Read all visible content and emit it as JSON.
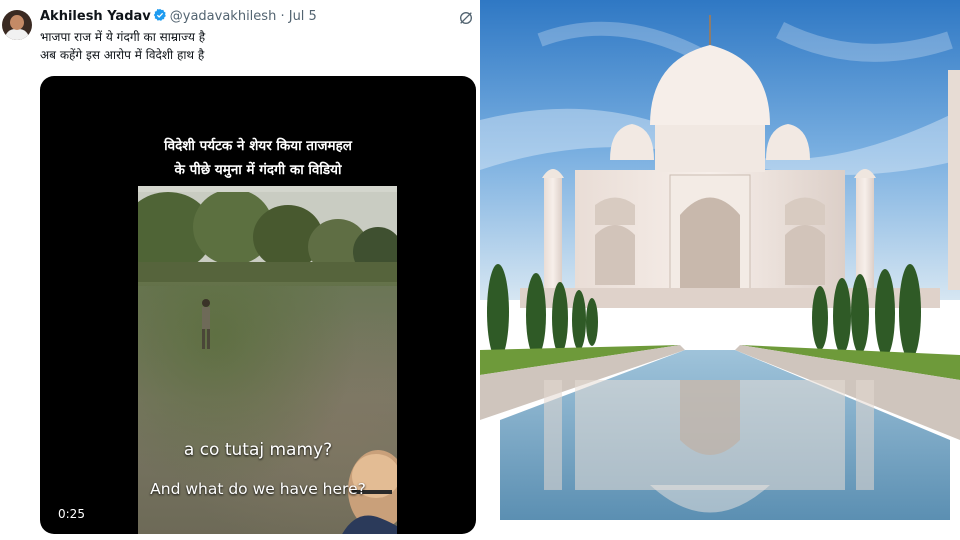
{
  "tweet": {
    "author_name": "Akhilesh Yadav",
    "handle": "@yadavakhilesh",
    "separator": "·",
    "date": "Jul 5",
    "text_line1": "भाजपा राज में ये गंदगी का साम्राज्य है",
    "text_line2": "अब कहेंगे इस आरोप में विदेशी हाथ है"
  },
  "video": {
    "caption_line1": "विदेशी पर्यटक ने शेयर किया ताजमहल",
    "caption_line2": "के पीछे यमुना में गंदगी का विडियो",
    "subtitle_line1": "a co tutaj mamy?",
    "subtitle_line2": "And what do we have here?",
    "timestamp": "0:25"
  },
  "icons": {
    "verified": "verified-badge-icon",
    "grok": "grok-icon"
  },
  "colors": {
    "verified_blue": "#1d9bf0",
    "handle_gray": "#536471",
    "text_dark": "#0f1419",
    "video_bg": "#000000"
  }
}
